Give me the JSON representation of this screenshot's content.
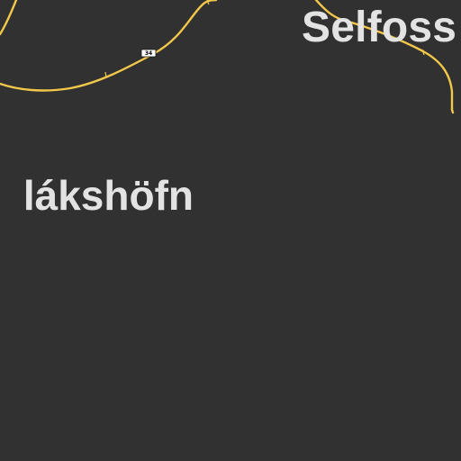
{
  "map": {
    "background_color": "#313131",
    "road_color": "#f2c84b",
    "label_color": "#e3e3e3"
  },
  "places": [
    {
      "name": "Selfoss"
    },
    {
      "name": "lákshöfn"
    }
  ],
  "road_shields": [
    {
      "number": "34"
    }
  ]
}
